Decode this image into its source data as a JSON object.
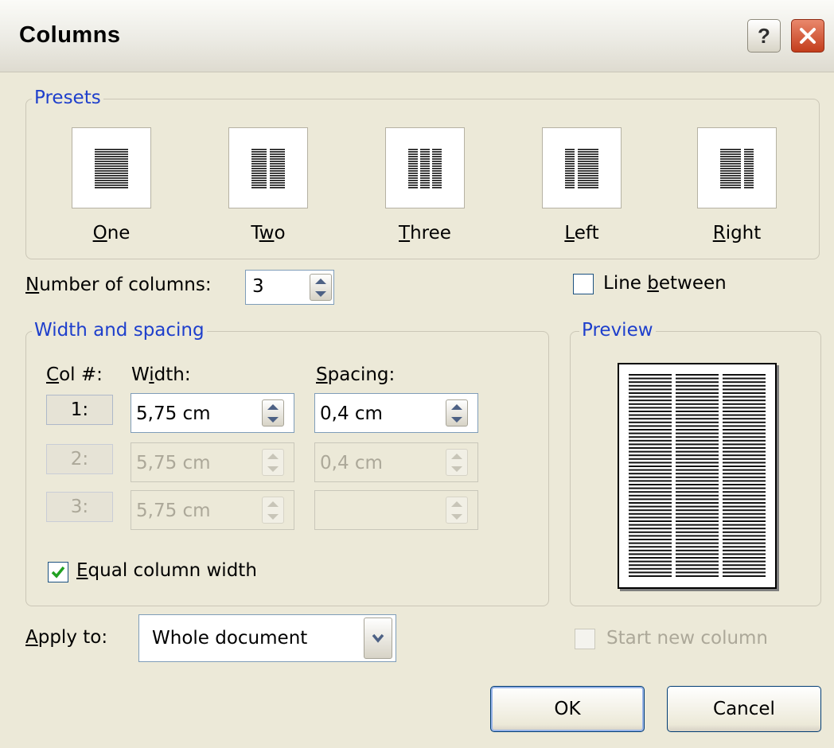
{
  "window": {
    "title": "Columns"
  },
  "presets": {
    "legend": "Presets",
    "items": [
      {
        "key": "one",
        "label": "One",
        "accel": "O"
      },
      {
        "key": "two",
        "label": "Two",
        "accel": "w"
      },
      {
        "key": "three",
        "label": "Three",
        "accel": "T"
      },
      {
        "key": "left",
        "label": "Left",
        "accel": "L"
      },
      {
        "key": "right",
        "label": "Right",
        "accel": "R"
      }
    ]
  },
  "number_of_columns": {
    "label": "Number of columns:",
    "value": "3"
  },
  "line_between": {
    "label": "Line between",
    "checked": false
  },
  "width_spacing": {
    "legend": "Width and spacing",
    "headers": {
      "col": "Col #:",
      "width": "Width:",
      "spacing": "Spacing:"
    },
    "rows": [
      {
        "col": "1:",
        "width": "5,75 cm",
        "spacing": "0,4 cm",
        "enabled": true
      },
      {
        "col": "2:",
        "width": "5,75 cm",
        "spacing": "0,4 cm",
        "enabled": false
      },
      {
        "col": "3:",
        "width": "5,75 cm",
        "spacing": "",
        "enabled": false
      }
    ],
    "equal_width": {
      "label": "Equal column width",
      "checked": true
    }
  },
  "preview": {
    "legend": "Preview",
    "columns": 3
  },
  "apply_to": {
    "label": "Apply to:",
    "value": "Whole document"
  },
  "start_new_column": {
    "label": "Start new column",
    "checked": false,
    "enabled": false
  },
  "buttons": {
    "ok": "OK",
    "cancel": "Cancel"
  }
}
